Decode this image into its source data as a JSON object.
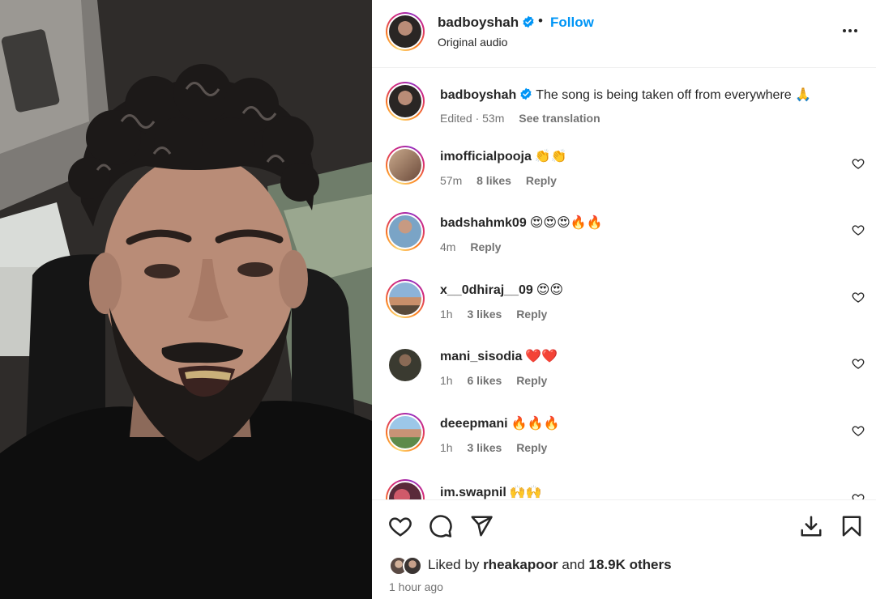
{
  "post": {
    "username": "badboyshah",
    "follow_label": "Follow",
    "dot": "•",
    "audio": "Original audio",
    "caption": "The song is being taken off from everywhere 🙏",
    "caption_meta_edited": "Edited · 53m",
    "see_translation": "See translation"
  },
  "comments": [
    {
      "user": "imofficialpooja",
      "text": "👏👏",
      "time": "57m",
      "likes": "8 likes",
      "reply": "Reply"
    },
    {
      "user": "badshahmk09",
      "text": "😍😍😍🔥🔥",
      "time": "4m",
      "likes": "",
      "reply": "Reply"
    },
    {
      "user": "x__0dhiraj__09",
      "text": "😍😍",
      "time": "1h",
      "likes": "3 likes",
      "reply": "Reply"
    },
    {
      "user": "mani_sisodia",
      "text": "❤️❤️",
      "time": "1h",
      "likes": "6 likes",
      "reply": "Reply"
    },
    {
      "user": "deeepmani",
      "text": "🔥🔥🔥",
      "time": "1h",
      "likes": "3 likes",
      "reply": "Reply"
    },
    {
      "user": "im.swapnil",
      "text": "🙌🙌",
      "time": "",
      "likes": "",
      "reply": ""
    }
  ],
  "likes": {
    "prefix": "Liked by",
    "user": "rheakapoor",
    "and": "and",
    "others": "18.9K others"
  },
  "posted_time": "1 hour ago",
  "colors": {
    "accent": "#0095f6",
    "verified": "#0095f6",
    "muted": "#737373"
  },
  "icons": [
    "verified-badge-icon",
    "more-options-icon",
    "heart-icon",
    "comment-icon",
    "share-icon",
    "download-icon",
    "save-bookmark-icon"
  ]
}
